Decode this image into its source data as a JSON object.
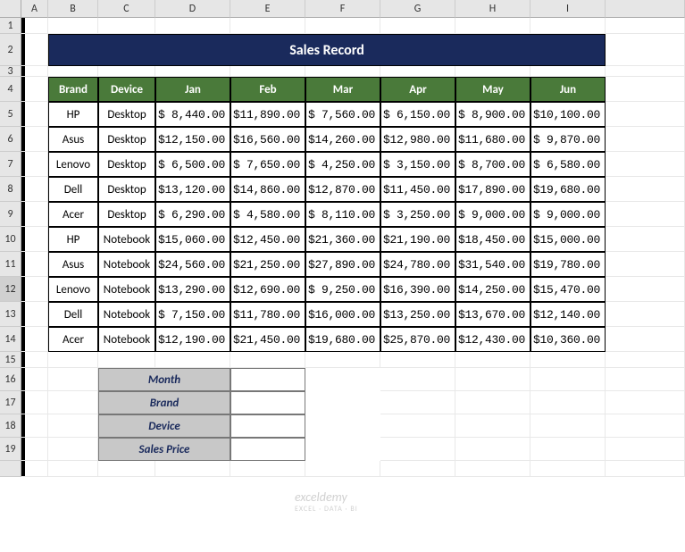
{
  "columns": [
    "A",
    "B",
    "C",
    "D",
    "E",
    "F",
    "G",
    "H",
    "I"
  ],
  "rows": [
    "1",
    "2",
    "3",
    "4",
    "5",
    "6",
    "7",
    "8",
    "9",
    "10",
    "11",
    "12",
    "13",
    "14",
    "15",
    "16",
    "17",
    "18",
    "19"
  ],
  "title": "Sales Record",
  "headers": [
    "Brand",
    "Device",
    "Jan",
    "Feb",
    "Mar",
    "Apr",
    "May",
    "Jun"
  ],
  "data": [
    {
      "brand": "HP",
      "device": "Desktop",
      "vals": [
        "$  8,440.00",
        "$11,890.00",
        "$  7,560.00",
        "$  6,150.00",
        "$  8,900.00",
        "$10,100.00"
      ]
    },
    {
      "brand": "Asus",
      "device": "Desktop",
      "vals": [
        "$12,150.00",
        "$16,560.00",
        "$14,260.00",
        "$12,980.00",
        "$11,680.00",
        "$  9,870.00"
      ]
    },
    {
      "brand": "Lenovo",
      "device": "Desktop",
      "vals": [
        "$  6,500.00",
        "$  7,650.00",
        "$  4,250.00",
        "$  3,150.00",
        "$  8,700.00",
        "$  6,580.00"
      ]
    },
    {
      "brand": "Dell",
      "device": "Desktop",
      "vals": [
        "$13,120.00",
        "$14,860.00",
        "$12,870.00",
        "$11,450.00",
        "$17,890.00",
        "$19,680.00"
      ]
    },
    {
      "brand": "Acer",
      "device": "Desktop",
      "vals": [
        "$  6,290.00",
        "$  4,580.00",
        "$  8,110.00",
        "$  3,250.00",
        "$  9,000.00",
        "$  9,000.00"
      ]
    },
    {
      "brand": "HP",
      "device": "Notebook",
      "vals": [
        "$15,060.00",
        "$12,450.00",
        "$21,360.00",
        "$21,190.00",
        "$18,450.00",
        "$15,000.00"
      ]
    },
    {
      "brand": "Asus",
      "device": "Notebook",
      "vals": [
        "$24,560.00",
        "$21,250.00",
        "$27,890.00",
        "$24,780.00",
        "$31,540.00",
        "$19,780.00"
      ]
    },
    {
      "brand": "Lenovo",
      "device": "Notebook",
      "vals": [
        "$13,290.00",
        "$12,690.00",
        "$  9,250.00",
        "$16,390.00",
        "$14,250.00",
        "$15,470.00"
      ]
    },
    {
      "brand": "Dell",
      "device": "Notebook",
      "vals": [
        "$  7,150.00",
        "$11,780.00",
        "$16,000.00",
        "$13,250.00",
        "$13,670.00",
        "$12,140.00"
      ]
    },
    {
      "brand": "Acer",
      "device": "Notebook",
      "vals": [
        "$12,190.00",
        "$21,450.00",
        "$19,680.00",
        "$25,870.00",
        "$12,430.00",
        "$10,360.00"
      ]
    }
  ],
  "lookup": {
    "labels": [
      "Month",
      "Brand",
      "Device",
      "Sales Price"
    ],
    "values": [
      "",
      "",
      "",
      ""
    ]
  },
  "watermark": {
    "main": "exceldemy",
    "sub": "EXCEL · DATA · BI"
  },
  "chart_data": {
    "type": "table",
    "title": "Sales Record",
    "categories": [
      "Jan",
      "Feb",
      "Mar",
      "Apr",
      "May",
      "Jun"
    ],
    "series": [
      {
        "name": "HP Desktop",
        "values": [
          8440,
          11890,
          7560,
          6150,
          8900,
          10100
        ]
      },
      {
        "name": "Asus Desktop",
        "values": [
          12150,
          16560,
          14260,
          12980,
          11680,
          9870
        ]
      },
      {
        "name": "Lenovo Desktop",
        "values": [
          6500,
          7650,
          4250,
          3150,
          8700,
          6580
        ]
      },
      {
        "name": "Dell Desktop",
        "values": [
          13120,
          14860,
          12870,
          11450,
          17890,
          19680
        ]
      },
      {
        "name": "Acer Desktop",
        "values": [
          6290,
          4580,
          8110,
          3250,
          9000,
          9000
        ]
      },
      {
        "name": "HP Notebook",
        "values": [
          15060,
          12450,
          21360,
          21190,
          18450,
          15000
        ]
      },
      {
        "name": "Asus Notebook",
        "values": [
          24560,
          21250,
          27890,
          24780,
          31540,
          19780
        ]
      },
      {
        "name": "Lenovo Notebook",
        "values": [
          13290,
          12690,
          9250,
          16390,
          14250,
          15470
        ]
      },
      {
        "name": "Dell Notebook",
        "values": [
          7150,
          11780,
          16000,
          13250,
          13670,
          12140
        ]
      },
      {
        "name": "Acer Notebook",
        "values": [
          12190,
          21450,
          19680,
          25870,
          12430,
          10360
        ]
      }
    ]
  }
}
